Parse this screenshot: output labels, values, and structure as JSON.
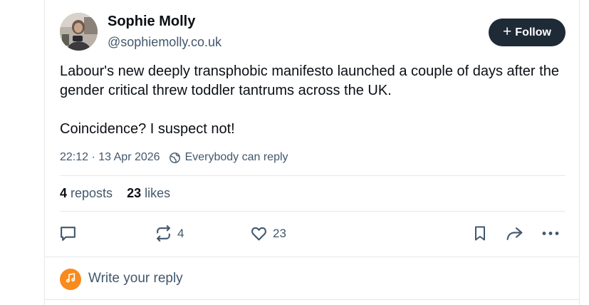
{
  "post": {
    "author": {
      "display_name": "Sophie Molly",
      "handle": "@sophiemolly.co.uk"
    },
    "follow_label": "Follow",
    "text_paragraphs": [
      "Labour's new deeply transphobic manifesto launched a couple of days after the gender critical threw toddler tantrums across the UK.",
      "Coincidence? I suspect not!"
    ],
    "timestamp": "22:12 · 13 Apr 2026",
    "reply_setting": "Everybody can reply",
    "stats": {
      "reposts_count": "4",
      "reposts_label": "reposts",
      "likes_count": "23",
      "likes_label": "likes"
    },
    "actions": {
      "repost_count": "4",
      "like_count": "23"
    }
  },
  "reply_box": {
    "placeholder": "Write your reply"
  },
  "icons": {
    "follow": "plus-icon",
    "reply_setting": "globe-icon",
    "reply": "comment-icon",
    "repost": "repost-icon",
    "like": "heart-icon",
    "bookmark": "bookmark-icon",
    "share": "share-icon",
    "more": "more-dots-icon",
    "reply_avatar": "music-note-icon"
  },
  "colors": {
    "follow_button_bg": "#1f2a37",
    "muted_text": "#42576c",
    "reply_avatar_bg": "#f98a1c",
    "divider": "#e4e8ec"
  }
}
